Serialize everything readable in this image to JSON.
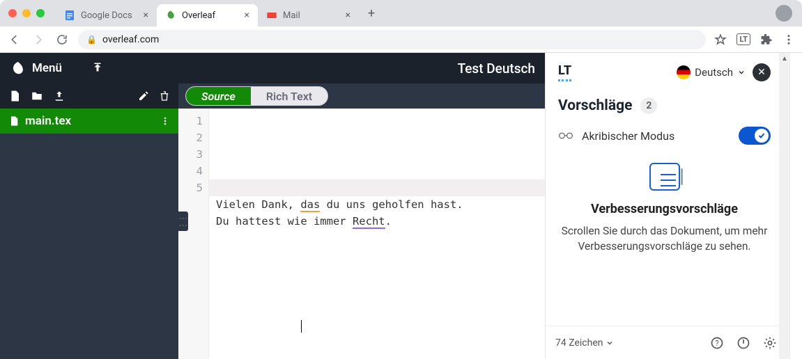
{
  "browser": {
    "tabs": [
      {
        "label": "Google Docs",
        "favicon": "📄"
      },
      {
        "label": "Overleaf",
        "favicon": "🍃"
      },
      {
        "label": "Mail",
        "favicon": "M"
      }
    ],
    "url": "overleaf.com"
  },
  "overleaf": {
    "menu_label": "Menü",
    "project_title": "Test Deutsch",
    "mode_source": "Source",
    "mode_rich": "Rich Text",
    "file_name": "main.tex",
    "line_numbers": [
      "1",
      "2",
      "3",
      "4",
      "5"
    ],
    "code_line3_pre": "Vielen Dank, ",
    "code_line3_err": "das",
    "code_line3_post": " du uns geholfen hast.",
    "code_line4_pre": "Du hattest wie immer ",
    "code_line4_err": "Recht",
    "code_line4_post": "."
  },
  "lt": {
    "language": "Deutsch",
    "section_title": "Vorschläge",
    "count": "2",
    "mode_label": "Akribischer Modus",
    "sugg_title": "Verbesserungsvorschläge",
    "sugg_desc": "Scrollen Sie durch das Dokument, um mehr Verbesserungsvorschläge zu sehen.",
    "char_count": "74 Zeichen"
  }
}
